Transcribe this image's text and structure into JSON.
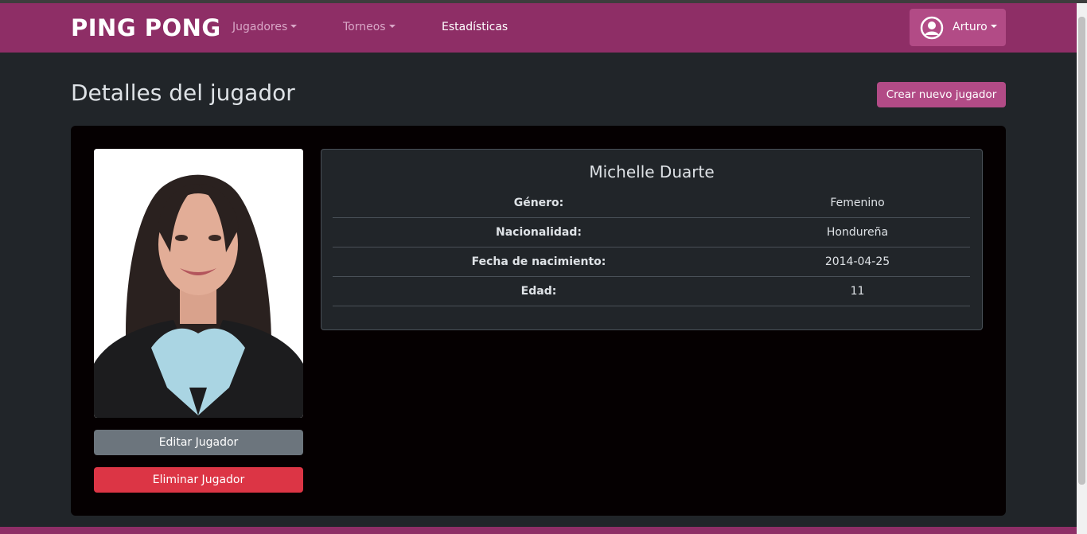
{
  "navbar": {
    "brand": "PING PONG",
    "links": [
      {
        "label": "Jugadores",
        "dropdown": true
      },
      {
        "label": "Torneos",
        "dropdown": true
      },
      {
        "label": "Estadísticas",
        "dropdown": false
      }
    ],
    "user": {
      "name": "Arturo",
      "icon": "user-circle-icon"
    }
  },
  "page": {
    "title": "Detalles del jugador",
    "create_button": "Crear nuevo jugador"
  },
  "player": {
    "name": "Michelle Duarte",
    "fields": [
      {
        "label": "Género:",
        "value": "Femenino"
      },
      {
        "label": "Nacionalidad:",
        "value": "Hondureña"
      },
      {
        "label": "Fecha de nacimiento:",
        "value": "2014-04-25"
      },
      {
        "label": "Edad:",
        "value": "11"
      }
    ]
  },
  "actions": {
    "edit": "Editar Jugador",
    "delete": "Eliminar Jugador"
  },
  "colors": {
    "navbar": "#8e2e66",
    "accent": "#b24b86",
    "danger": "#dc3545",
    "secondary": "#6c757d",
    "background": "#212529"
  }
}
